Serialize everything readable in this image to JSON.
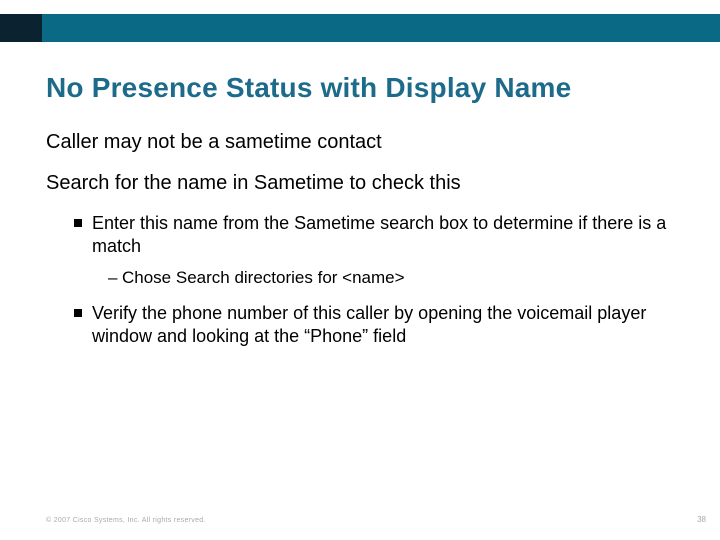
{
  "title": "No Presence Status with Display Name",
  "lvl1": {
    "p1": "Caller may not be a sametime contact",
    "p2": "Search for the name in Sametime to check this"
  },
  "lvl2": {
    "b1": "Enter this name from the Sametime search box to determine if there is a match",
    "b2": "Verify the phone number of this caller by opening the voicemail player window and looking at the “Phone” field"
  },
  "lvl3": {
    "s1": "Chose Search directories for <name>"
  },
  "footer": {
    "copyright": "© 2007 Cisco Systems, Inc. All rights reserved.",
    "page": "38"
  }
}
